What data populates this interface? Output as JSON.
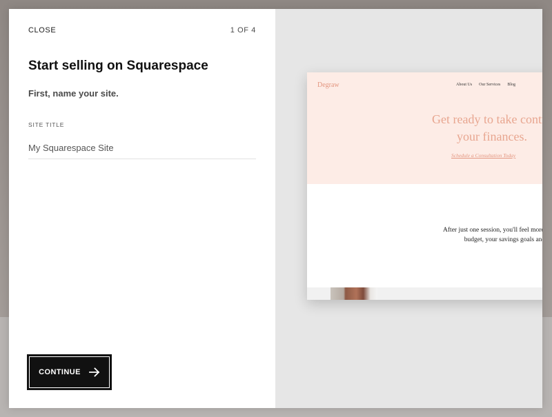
{
  "modal": {
    "close_label": "CLOSE",
    "step": "1 OF 4",
    "title": "Start selling on Squarespace",
    "subtitle": "First, name your site.",
    "field_label": "SITE TITLE",
    "site_title_value": "My Squarespace Site",
    "continue_label": "CONTINUE",
    "continue_icon": "arrow-right-icon"
  },
  "preview": {
    "logo": "Degraw",
    "nav": [
      "About Us",
      "Our Services",
      "Blog"
    ],
    "headline_line1": "Get ready to take contro",
    "headline_line2": "your finances.",
    "cta": "Schedule a Consultation Today",
    "body_line1": "After just one session, you'll feel more in contro",
    "body_line2": "budget, your savings goals and your life",
    "colors": {
      "hero_bg": "#fdece6",
      "accent": "#e39680"
    }
  },
  "colors": {
    "button_bg": "#111111",
    "panel_bg": "#ffffff",
    "preview_bg": "#e6e6e6"
  }
}
